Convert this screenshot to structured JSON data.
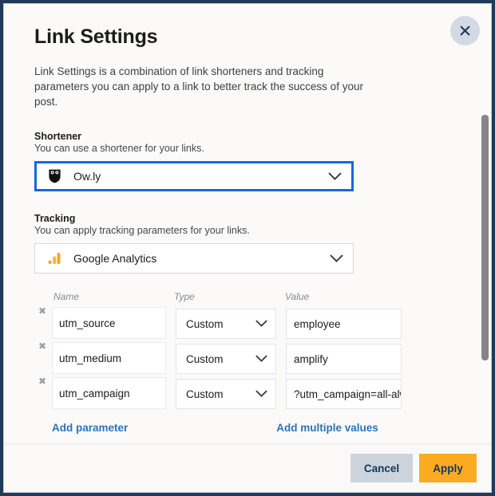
{
  "dialog": {
    "title": "Link Settings",
    "description": "Link Settings is a combination of link shorteners and tracking parameters you can apply to a link to better track the success of your post.",
    "close_icon": "close-icon"
  },
  "shortener": {
    "label": "Shortener",
    "sublabel": "You can use a shortener for your links.",
    "selected": "Ow.ly",
    "icon": "owly-owl-icon",
    "focused": true,
    "focus_color": "#1668dc"
  },
  "tracking": {
    "label": "Tracking",
    "sublabel": "You can apply tracking parameters for your links.",
    "selected": "Google Analytics",
    "icon": "google-analytics-icon",
    "icon_color": "#f5a623"
  },
  "parameters": {
    "headers": {
      "name": "Name",
      "type": "Type",
      "value": "Value"
    },
    "rows": [
      {
        "name": "utm_source",
        "type": "Custom",
        "value": "employee"
      },
      {
        "name": "utm_medium",
        "type": "Custom",
        "value": "amplify"
      },
      {
        "name": "utm_campaign",
        "type": "Custom",
        "value": "?utm_campaign=all-alwa"
      }
    ],
    "add_parameter_label": "Add parameter",
    "add_multiple_values_label": "Add multiple values",
    "link_color": "#2b74b8"
  },
  "footer": {
    "cancel_label": "Cancel",
    "apply_label": "Apply",
    "cancel_color": "#ccd4de",
    "apply_color": "#fbab21"
  }
}
